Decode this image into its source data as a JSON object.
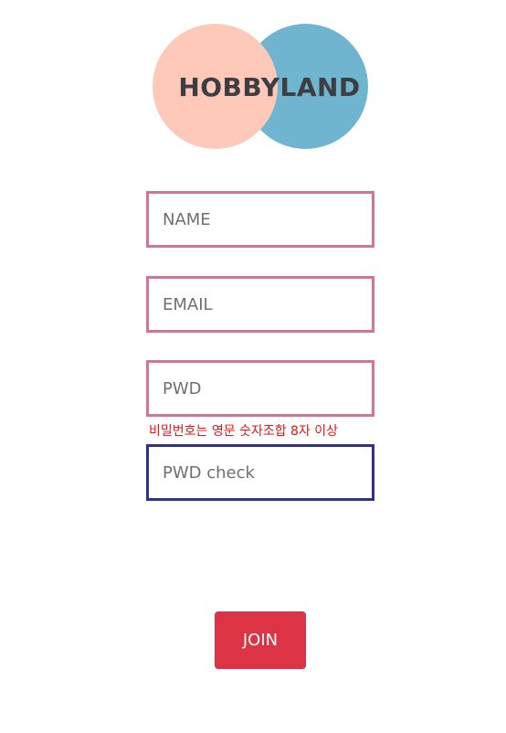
{
  "logo": {
    "text": "HOBBYLAND",
    "left_circle_color": "#fec9b8",
    "right_circle_color": "#6fb5cf"
  },
  "form": {
    "name": {
      "placeholder": "NAME",
      "value": ""
    },
    "email": {
      "placeholder": "EMAIL",
      "value": ""
    },
    "pwd": {
      "placeholder": "PWD",
      "value": ""
    },
    "pwd_hint": "비밀번호는 영문 숫자조합 8자 이상",
    "pwd_check": {
      "placeholder": "PWD check",
      "value": ""
    },
    "join_label": "JOIN"
  },
  "colors": {
    "field_border": "#d2739a",
    "focused_border": "#30308f",
    "hint_text": "#e01616",
    "join_button": "#dc3445"
  }
}
